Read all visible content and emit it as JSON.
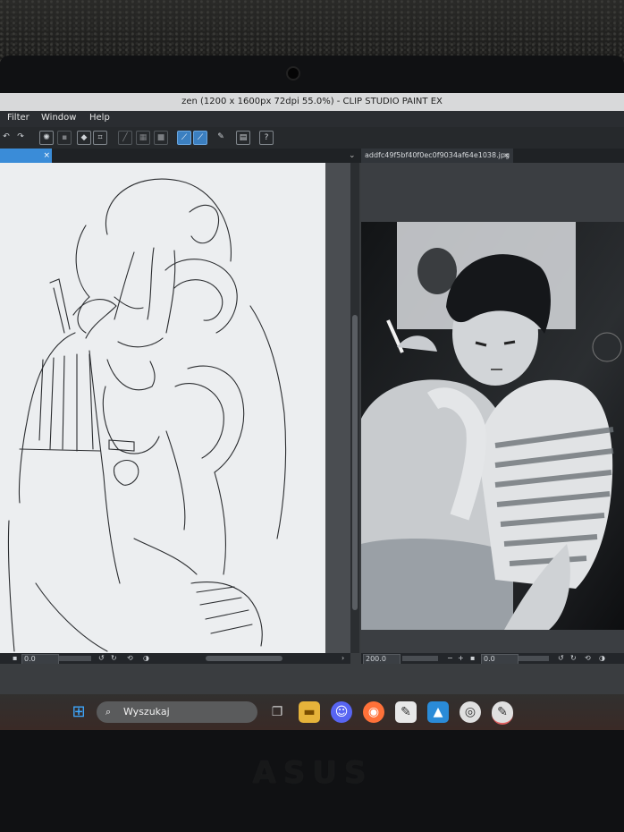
{
  "window": {
    "title": "zen (1200 x 1600px 72dpi 55.0%)  - CLIP STUDIO PAINT EX"
  },
  "menu": {
    "items": [
      "Filter",
      "Window",
      "Help"
    ]
  },
  "toolbar": {
    "icons": [
      "undo-icon",
      "redo-icon",
      "settings-icon",
      "transform-icon",
      "clear-icon",
      "fill-icon",
      "crop-icon",
      "ruler-icon",
      "layer-icon",
      "frame-icon",
      "snap-ruler-icon",
      "snap-special-icon",
      "pen-icon",
      "book-icon",
      "help-icon"
    ]
  },
  "tabs": {
    "left_close": "×",
    "chevron": "⌄",
    "right_label": "addfc49f5bf40f0ec0f9034af64e1038.jpg",
    "right_close": "×"
  },
  "status_left": {
    "value": "0.0"
  },
  "status_right": {
    "zoom": "200.0",
    "value": "0.0"
  },
  "taskbar": {
    "search_placeholder": "Wyszukaj",
    "apps": [
      "windows-start-icon",
      "task-view-icon",
      "file-explorer-icon",
      "discord-icon",
      "firefox-icon",
      "notepad-icon",
      "photos-icon",
      "clip-studio-icon",
      "clip-studio-paint-icon"
    ]
  },
  "laptop": {
    "brand": "ASUS"
  },
  "colors": {
    "accent": "#3a8cd8",
    "menu_bg": "#2a2d31",
    "paper": "#eceef0"
  }
}
